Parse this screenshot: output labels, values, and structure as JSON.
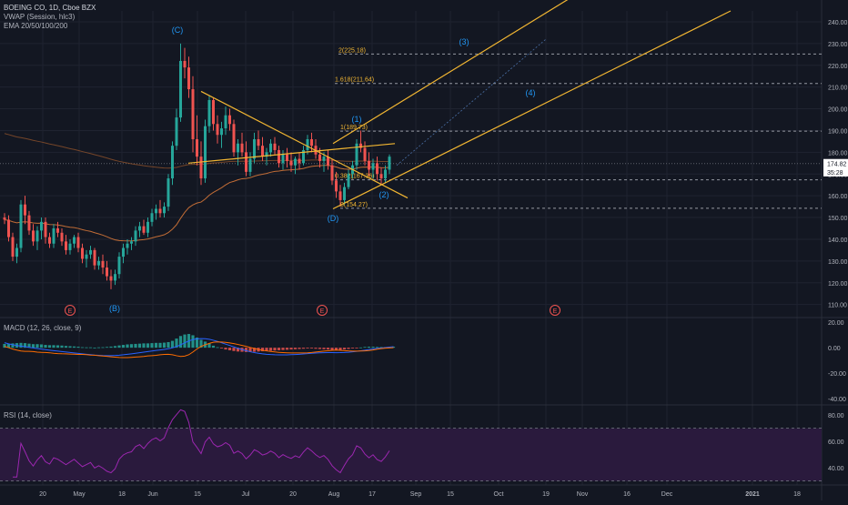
{
  "colors": {
    "background": "#131722",
    "up": "#26a69a",
    "down": "#ef5350",
    "trendline": "#f2b632",
    "fib_text": "#f2b632",
    "fib_line": "#9598a1",
    "wave_label": "#2196f3",
    "ema": "#e07b39",
    "macd_line": "#2962ff",
    "macd_signal": "#ff6d00",
    "rsi_line": "#9c27b0",
    "rsi_band": "#2a1a3d",
    "grid": "#1f2330",
    "axis_text": "#b2b5be",
    "price_badge": "#ffffff"
  },
  "header": {
    "symbol_line": "BOEING CO, 1D, Cboe BZX",
    "vwap_label": "VWAP (Session, hlc3)",
    "ema_label": "EMA 20/50/100/200"
  },
  "chart_data": [
    {
      "type": "candlestick",
      "title": "BOEING CO, 1D, Cboe BZX",
      "ylim": [
        104,
        245
      ],
      "y_ticks": [
        "240.00",
        "230.00",
        "220.00",
        "210.00",
        "200.00",
        "190.00",
        "180.00",
        "170.00",
        "160.00",
        "150.00",
        "140.00",
        "130.00",
        "120.00",
        "110.00"
      ],
      "y_tick_values": [
        240,
        230,
        220,
        210,
        200,
        190,
        180,
        170,
        160,
        150,
        140,
        130,
        120,
        110
      ],
      "price_badges": [
        {
          "text": "174.82",
          "value": 174.82
        },
        {
          "text": "35:28",
          "value": 171.0
        }
      ],
      "candles": [
        [
          150,
          152,
          147,
          149
        ],
        [
          149,
          151,
          139,
          141
        ],
        [
          141,
          143,
          130,
          132
        ],
        [
          132,
          138,
          129,
          136
        ],
        [
          136,
          158,
          134,
          156
        ],
        [
          156,
          160,
          147,
          151
        ],
        [
          151,
          153,
          142,
          144
        ],
        [
          144,
          147,
          137,
          139
        ],
        [
          139,
          146,
          135,
          144
        ],
        [
          144,
          150,
          140,
          148
        ],
        [
          148,
          150,
          138,
          141
        ],
        [
          141,
          143,
          136,
          138
        ],
        [
          138,
          147,
          136,
          145
        ],
        [
          145,
          148,
          141,
          143
        ],
        [
          143,
          145,
          137,
          139
        ],
        [
          139,
          142,
          133,
          135
        ],
        [
          135,
          140,
          133,
          138
        ],
        [
          138,
          142,
          136,
          141
        ],
        [
          141,
          143,
          134,
          136
        ],
        [
          136,
          138,
          129,
          131
        ],
        [
          131,
          135,
          127,
          133
        ],
        [
          133,
          137,
          131,
          135
        ],
        [
          135,
          136,
          126,
          128
        ],
        [
          128,
          132,
          126,
          130
        ],
        [
          130,
          133,
          124,
          127
        ],
        [
          127,
          130,
          121,
          123
        ],
        [
          123,
          126,
          117,
          121
        ],
        [
          121,
          126,
          119,
          124
        ],
        [
          124,
          134,
          122,
          132
        ],
        [
          132,
          138,
          129,
          136
        ],
        [
          136,
          140,
          133,
          138
        ],
        [
          138,
          141,
          135,
          139
        ],
        [
          139,
          146,
          137,
          144
        ],
        [
          144,
          148,
          141,
          146
        ],
        [
          146,
          149,
          142,
          143
        ],
        [
          143,
          150,
          141,
          148
        ],
        [
          148,
          154,
          146,
          152
        ],
        [
          152,
          156,
          149,
          154
        ],
        [
          154,
          158,
          150,
          152
        ],
        [
          152,
          157,
          150,
          155
        ],
        [
          155,
          170,
          153,
          168
        ],
        [
          168,
          185,
          165,
          183
        ],
        [
          183,
          200,
          181,
          196
        ],
        [
          196,
          230,
          194,
          222
        ],
        [
          222,
          228,
          214,
          219
        ],
        [
          219,
          224,
          205,
          209
        ],
        [
          209,
          215,
          180,
          186
        ],
        [
          186,
          197,
          174,
          178
        ],
        [
          178,
          185,
          165,
          168
        ],
        [
          168,
          195,
          166,
          192
        ],
        [
          192,
          206,
          189,
          204
        ],
        [
          204,
          205,
          190,
          193
        ],
        [
          193,
          197,
          184,
          188
        ],
        [
          188,
          194,
          182,
          191
        ],
        [
          191,
          201,
          188,
          197
        ],
        [
          197,
          200,
          190,
          193
        ],
        [
          193,
          195,
          178,
          180
        ],
        [
          180,
          186,
          174,
          184
        ],
        [
          184,
          189,
          178,
          180
        ],
        [
          180,
          185,
          169,
          171
        ],
        [
          171,
          180,
          169,
          177
        ],
        [
          177,
          189,
          175,
          186
        ],
        [
          186,
          190,
          181,
          183
        ],
        [
          183,
          187,
          176,
          178
        ],
        [
          178,
          182,
          174,
          180
        ],
        [
          180,
          186,
          178,
          184
        ],
        [
          184,
          187,
          179,
          181
        ],
        [
          181,
          183,
          173,
          175
        ],
        [
          175,
          181,
          172,
          179
        ],
        [
          179,
          182,
          173,
          176
        ],
        [
          176,
          180,
          171,
          174
        ],
        [
          174,
          178,
          170,
          177
        ],
        [
          177,
          180,
          172,
          175
        ],
        [
          175,
          183,
          174,
          181
        ],
        [
          181,
          188,
          179,
          186
        ],
        [
          186,
          189,
          180,
          183
        ],
        [
          183,
          186,
          177,
          179
        ],
        [
          179,
          182,
          173,
          176
        ],
        [
          176,
          180,
          171,
          178
        ],
        [
          178,
          181,
          172,
          174
        ],
        [
          174,
          177,
          165,
          167
        ],
        [
          167,
          171,
          159,
          162
        ],
        [
          162,
          165,
          155,
          158
        ],
        [
          158,
          166,
          156,
          164
        ],
        [
          164,
          172,
          163,
          170
        ],
        [
          170,
          176,
          168,
          174
        ],
        [
          174,
          186,
          172,
          184
        ],
        [
          184,
          190,
          180,
          182
        ],
        [
          182,
          185,
          174,
          176
        ],
        [
          176,
          180,
          169,
          172
        ],
        [
          172,
          177,
          168,
          175
        ],
        [
          175,
          178,
          167,
          170
        ],
        [
          170,
          173,
          165,
          168
        ],
        [
          168,
          174,
          166,
          172
        ],
        [
          172,
          179,
          170,
          178
        ]
      ]
    },
    {
      "type": "bar",
      "title": "MACD (12, 26, close, 9)",
      "ylim": [
        -45,
        23
      ],
      "y_ticks": [
        "20.00",
        "0.00",
        "-20.00",
        "-40.00"
      ],
      "y_tick_values": [
        20,
        0,
        -20,
        -40
      ],
      "histogram": [
        3,
        3,
        3.4,
        3.6,
        3.8,
        3.6,
        3.2,
        2.8,
        2.8,
        2.6,
        2.2,
        2,
        2,
        1.9,
        1.7,
        1.4,
        1.2,
        1,
        0.8,
        0.4,
        0.3,
        0.3,
        0.1,
        0.3,
        0.4,
        0.6,
        0.9,
        1.3,
        1.8,
        2.2,
        2.6,
        2.8,
        3,
        3.2,
        3.4,
        3.4,
        3.6,
        3.8,
        3.8,
        4,
        4.4,
        5.4,
        7.2,
        9.2,
        10.4,
        10.8,
        9.8,
        8,
        6.2,
        4.8,
        3.2,
        1.6,
        0.4,
        -0.6,
        -1.4,
        -2,
        -2.6,
        -3,
        -3.2,
        -3.4,
        -3.4,
        -3.2,
        -3,
        -2.8,
        -2.6,
        -2.4,
        -2.2,
        -2,
        -1.8,
        -1.6,
        -1.4,
        -1.2,
        -1,
        -0.8,
        -0.6,
        -0.6,
        -0.8,
        -1,
        -1.2,
        -1.4,
        -1.8,
        -2,
        -1.8,
        -1.4,
        -1,
        -0.6,
        -0.2,
        0.2,
        0.6,
        0.8,
        0.8,
        0.6,
        0.5,
        0.4,
        0.6,
        0.8
      ]
    },
    {
      "type": "line",
      "title": "RSI (14, close)",
      "ylim": [
        27,
        87
      ],
      "y_ticks": [
        "80.00",
        "60.00",
        "40.00"
      ],
      "y_tick_values": [
        80,
        60,
        40
      ],
      "band": [
        30,
        70
      ]
    }
  ],
  "x_axis": {
    "labels": [
      "20",
      "May",
      "18",
      "Jun",
      "15",
      "Jul",
      "20",
      "Aug",
      "17",
      "Sep",
      "15",
      "Oct",
      "19",
      "Nov",
      "16",
      "Dec",
      "2021",
      "18"
    ],
    "bold_labels": [
      "2021"
    ]
  },
  "annotations": {
    "waves": [
      {
        "text": "(C)"
      },
      {
        "text": "(B)"
      },
      {
        "text": "(D)"
      },
      {
        "text": "(1)"
      },
      {
        "text": "(2)"
      },
      {
        "text": "(3)"
      },
      {
        "text": "(4)"
      }
    ],
    "fib_levels": [
      {
        "text": "2(225.18)",
        "value": 225.18
      },
      {
        "text": "1.618(211.64)",
        "value": 211.64
      },
      {
        "text": "1(189.73)",
        "value": 189.73
      },
      {
        "text": "0.382(167.36)",
        "value": 167.36
      },
      {
        "text": "0(154.27)",
        "value": 154.27
      }
    ],
    "earnings_marker": "E"
  }
}
